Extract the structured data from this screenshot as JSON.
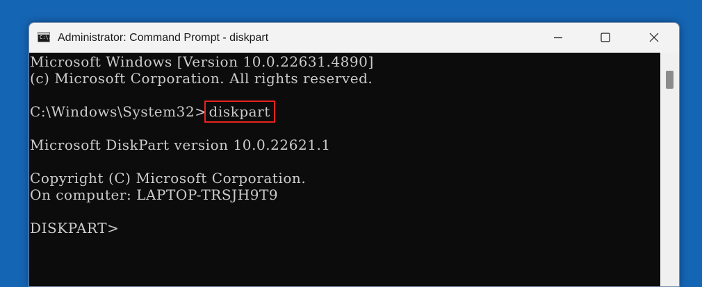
{
  "window": {
    "title": "Administrator: Command Prompt - diskpart",
    "app_icon_text": "C:\\.",
    "controls": {
      "minimize": "minimize-icon",
      "maximize": "maximize-icon",
      "close": "close-icon"
    }
  },
  "console": {
    "line1": "Microsoft Windows [Version 10.0.22631.4890]",
    "line2": "(c) Microsoft Corporation. All rights reserved.",
    "prompt_path": "C:\\Windows\\System32>",
    "command": "diskpart",
    "diskpart_version": "Microsoft DiskPart version 10.0.22621.1",
    "copyright": "Copyright (C) Microsoft Corporation.",
    "computer": "On computer: LAPTOP-TRSJH9T9",
    "diskpart_prompt": "DISKPART>"
  },
  "colors": {
    "desktop": "#1565b5",
    "console_bg": "#0c0c0c",
    "console_text": "#cccccc",
    "highlight_box": "#e8231c",
    "titlebar_bg": "#f3f3f3"
  }
}
